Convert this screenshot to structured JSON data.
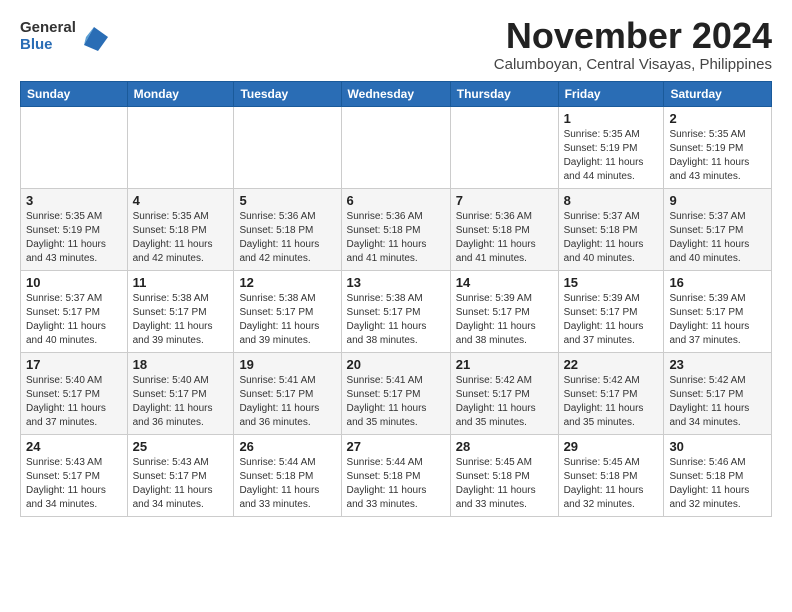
{
  "logo": {
    "general": "General",
    "blue": "Blue"
  },
  "header": {
    "month": "November 2024",
    "location": "Calumboyan, Central Visayas, Philippines"
  },
  "weekdays": [
    "Sunday",
    "Monday",
    "Tuesday",
    "Wednesday",
    "Thursday",
    "Friday",
    "Saturday"
  ],
  "weeks": [
    [
      {
        "day": "",
        "sunrise": "",
        "sunset": "",
        "daylight": ""
      },
      {
        "day": "",
        "sunrise": "",
        "sunset": "",
        "daylight": ""
      },
      {
        "day": "",
        "sunrise": "",
        "sunset": "",
        "daylight": ""
      },
      {
        "day": "",
        "sunrise": "",
        "sunset": "",
        "daylight": ""
      },
      {
        "day": "",
        "sunrise": "",
        "sunset": "",
        "daylight": ""
      },
      {
        "day": "1",
        "sunrise": "Sunrise: 5:35 AM",
        "sunset": "Sunset: 5:19 PM",
        "daylight": "Daylight: 11 hours and 44 minutes."
      },
      {
        "day": "2",
        "sunrise": "Sunrise: 5:35 AM",
        "sunset": "Sunset: 5:19 PM",
        "daylight": "Daylight: 11 hours and 43 minutes."
      }
    ],
    [
      {
        "day": "3",
        "sunrise": "Sunrise: 5:35 AM",
        "sunset": "Sunset: 5:19 PM",
        "daylight": "Daylight: 11 hours and 43 minutes."
      },
      {
        "day": "4",
        "sunrise": "Sunrise: 5:35 AM",
        "sunset": "Sunset: 5:18 PM",
        "daylight": "Daylight: 11 hours and 42 minutes."
      },
      {
        "day": "5",
        "sunrise": "Sunrise: 5:36 AM",
        "sunset": "Sunset: 5:18 PM",
        "daylight": "Daylight: 11 hours and 42 minutes."
      },
      {
        "day": "6",
        "sunrise": "Sunrise: 5:36 AM",
        "sunset": "Sunset: 5:18 PM",
        "daylight": "Daylight: 11 hours and 41 minutes."
      },
      {
        "day": "7",
        "sunrise": "Sunrise: 5:36 AM",
        "sunset": "Sunset: 5:18 PM",
        "daylight": "Daylight: 11 hours and 41 minutes."
      },
      {
        "day": "8",
        "sunrise": "Sunrise: 5:37 AM",
        "sunset": "Sunset: 5:18 PM",
        "daylight": "Daylight: 11 hours and 40 minutes."
      },
      {
        "day": "9",
        "sunrise": "Sunrise: 5:37 AM",
        "sunset": "Sunset: 5:17 PM",
        "daylight": "Daylight: 11 hours and 40 minutes."
      }
    ],
    [
      {
        "day": "10",
        "sunrise": "Sunrise: 5:37 AM",
        "sunset": "Sunset: 5:17 PM",
        "daylight": "Daylight: 11 hours and 40 minutes."
      },
      {
        "day": "11",
        "sunrise": "Sunrise: 5:38 AM",
        "sunset": "Sunset: 5:17 PM",
        "daylight": "Daylight: 11 hours and 39 minutes."
      },
      {
        "day": "12",
        "sunrise": "Sunrise: 5:38 AM",
        "sunset": "Sunset: 5:17 PM",
        "daylight": "Daylight: 11 hours and 39 minutes."
      },
      {
        "day": "13",
        "sunrise": "Sunrise: 5:38 AM",
        "sunset": "Sunset: 5:17 PM",
        "daylight": "Daylight: 11 hours and 38 minutes."
      },
      {
        "day": "14",
        "sunrise": "Sunrise: 5:39 AM",
        "sunset": "Sunset: 5:17 PM",
        "daylight": "Daylight: 11 hours and 38 minutes."
      },
      {
        "day": "15",
        "sunrise": "Sunrise: 5:39 AM",
        "sunset": "Sunset: 5:17 PM",
        "daylight": "Daylight: 11 hours and 37 minutes."
      },
      {
        "day": "16",
        "sunrise": "Sunrise: 5:39 AM",
        "sunset": "Sunset: 5:17 PM",
        "daylight": "Daylight: 11 hours and 37 minutes."
      }
    ],
    [
      {
        "day": "17",
        "sunrise": "Sunrise: 5:40 AM",
        "sunset": "Sunset: 5:17 PM",
        "daylight": "Daylight: 11 hours and 37 minutes."
      },
      {
        "day": "18",
        "sunrise": "Sunrise: 5:40 AM",
        "sunset": "Sunset: 5:17 PM",
        "daylight": "Daylight: 11 hours and 36 minutes."
      },
      {
        "day": "19",
        "sunrise": "Sunrise: 5:41 AM",
        "sunset": "Sunset: 5:17 PM",
        "daylight": "Daylight: 11 hours and 36 minutes."
      },
      {
        "day": "20",
        "sunrise": "Sunrise: 5:41 AM",
        "sunset": "Sunset: 5:17 PM",
        "daylight": "Daylight: 11 hours and 35 minutes."
      },
      {
        "day": "21",
        "sunrise": "Sunrise: 5:42 AM",
        "sunset": "Sunset: 5:17 PM",
        "daylight": "Daylight: 11 hours and 35 minutes."
      },
      {
        "day": "22",
        "sunrise": "Sunrise: 5:42 AM",
        "sunset": "Sunset: 5:17 PM",
        "daylight": "Daylight: 11 hours and 35 minutes."
      },
      {
        "day": "23",
        "sunrise": "Sunrise: 5:42 AM",
        "sunset": "Sunset: 5:17 PM",
        "daylight": "Daylight: 11 hours and 34 minutes."
      }
    ],
    [
      {
        "day": "24",
        "sunrise": "Sunrise: 5:43 AM",
        "sunset": "Sunset: 5:17 PM",
        "daylight": "Daylight: 11 hours and 34 minutes."
      },
      {
        "day": "25",
        "sunrise": "Sunrise: 5:43 AM",
        "sunset": "Sunset: 5:17 PM",
        "daylight": "Daylight: 11 hours and 34 minutes."
      },
      {
        "day": "26",
        "sunrise": "Sunrise: 5:44 AM",
        "sunset": "Sunset: 5:18 PM",
        "daylight": "Daylight: 11 hours and 33 minutes."
      },
      {
        "day": "27",
        "sunrise": "Sunrise: 5:44 AM",
        "sunset": "Sunset: 5:18 PM",
        "daylight": "Daylight: 11 hours and 33 minutes."
      },
      {
        "day": "28",
        "sunrise": "Sunrise: 5:45 AM",
        "sunset": "Sunset: 5:18 PM",
        "daylight": "Daylight: 11 hours and 33 minutes."
      },
      {
        "day": "29",
        "sunrise": "Sunrise: 5:45 AM",
        "sunset": "Sunset: 5:18 PM",
        "daylight": "Daylight: 11 hours and 32 minutes."
      },
      {
        "day": "30",
        "sunrise": "Sunrise: 5:46 AM",
        "sunset": "Sunset: 5:18 PM",
        "daylight": "Daylight: 11 hours and 32 minutes."
      }
    ]
  ]
}
